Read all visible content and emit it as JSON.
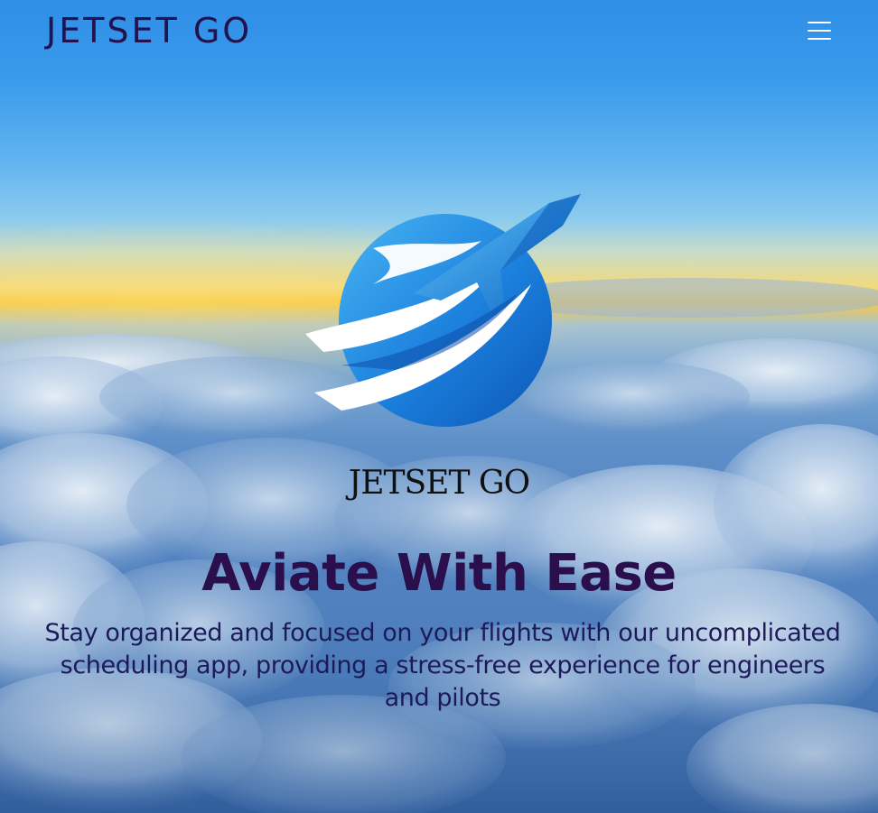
{
  "header": {
    "brand": "JETSET GO",
    "menu_icon": "hamburger-menu-icon"
  },
  "hero": {
    "logo_icon": "jet-globe-logo-icon",
    "logo_text": "JETSET GO",
    "headline": "Aviate With Ease",
    "subtext": "Stay organized and focused on your flights with our uncomplicated scheduling app, providing a stress-free experience for engineers and pilots",
    "background": "sky-above-clouds-photo"
  },
  "colors": {
    "brand_text": "#24124f",
    "headline": "#2a0f4c",
    "subtext": "#1d1a5a",
    "menu_icon": "#ffffff",
    "logo_blue": "#1f7fe0"
  }
}
